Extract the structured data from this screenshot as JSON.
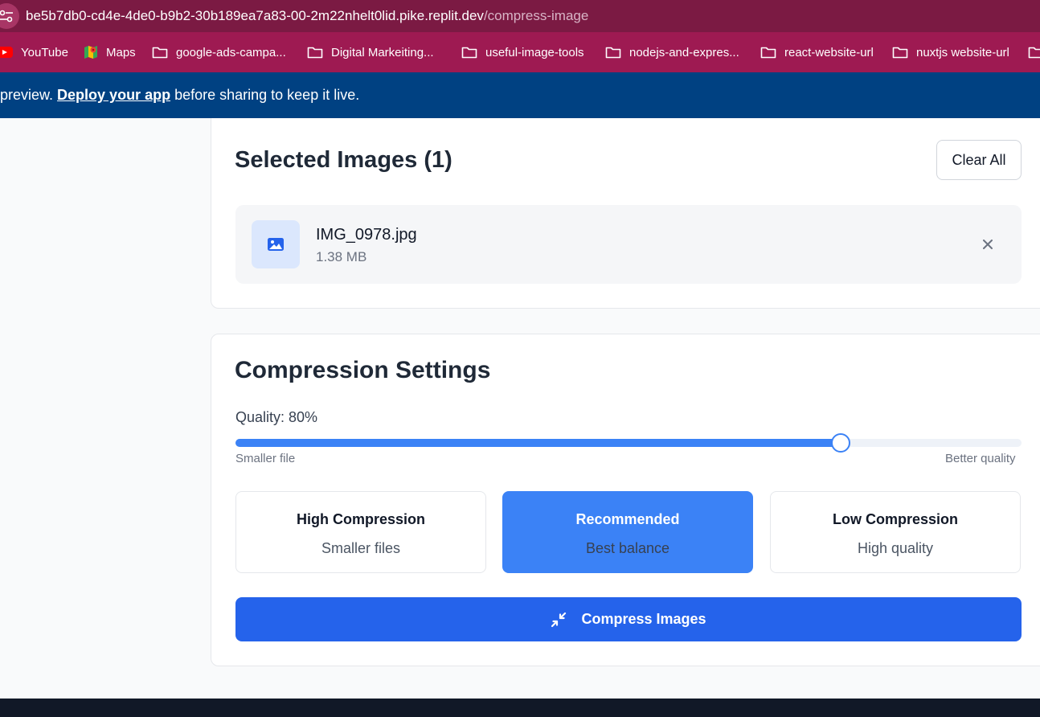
{
  "browser": {
    "url_host": "be5b7db0-cd4e-4de0-b9b2-30b189ea7a83-00-2m22nhelt0lid.pike.replit.dev",
    "url_path": "/compress-image",
    "bookmarks": [
      {
        "label": "YouTube",
        "icon": "youtube-icon"
      },
      {
        "label": "Maps",
        "icon": "maps-icon"
      },
      {
        "label": "google-ads-campa...",
        "icon": "folder-icon"
      },
      {
        "label": "Digital Markeiting...",
        "icon": "folder-icon"
      },
      {
        "label": "useful-image-tools",
        "icon": "folder-icon"
      },
      {
        "label": "nodejs-and-expres...",
        "icon": "folder-icon"
      },
      {
        "label": "react-website-url",
        "icon": "folder-icon"
      },
      {
        "label": "nuxtjs website-url",
        "icon": "folder-icon"
      }
    ]
  },
  "banner": {
    "prefix": "preview. ",
    "link": "Deploy your app",
    "suffix": " before sharing to keep it live."
  },
  "selected": {
    "title": "Selected Images (1)",
    "clear_label": "Clear All",
    "files": [
      {
        "name": "IMG_0978.jpg",
        "size": "1.38 MB",
        "icon": "image-icon"
      }
    ]
  },
  "settings": {
    "title": "Compression Settings",
    "quality_label": "Quality: 80%",
    "quality_value": 0.77,
    "min_label": "Smaller file",
    "max_label": "Better quality",
    "presets": [
      {
        "title": "High Compression",
        "subtitle": "Smaller files",
        "active": false
      },
      {
        "title": "Recommended",
        "subtitle": "Best balance",
        "active": true
      },
      {
        "title": "Low Compression",
        "subtitle": "High quality",
        "active": false
      }
    ],
    "compress_label": "Compress Images"
  },
  "colors": {
    "address_bar": "#7b1a43",
    "bookmarks_bar": "#9e1a52",
    "banner": "#004182",
    "accent": "#3b82f6",
    "primary_button": "#2563eb"
  }
}
